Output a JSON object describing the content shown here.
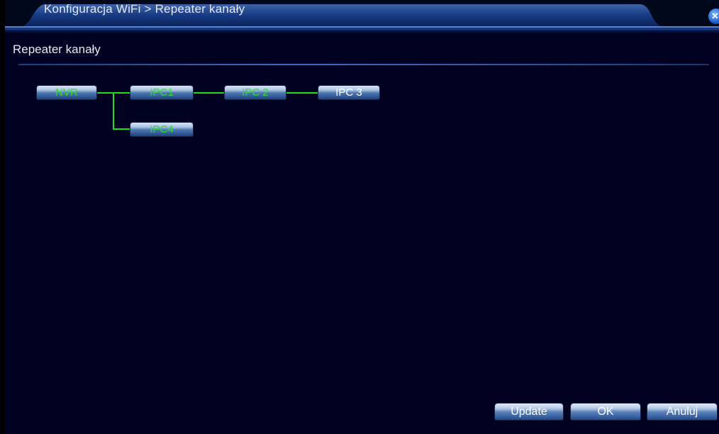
{
  "window": {
    "breadcrumb": "Konfiguracja WiFi > Repeater kanały",
    "close_glyph": "✕"
  },
  "section": {
    "title": "Repeater kanały"
  },
  "topology": {
    "nodes": [
      {
        "id": "nvr",
        "label": "NVR",
        "status": "connected"
      },
      {
        "id": "ipc1",
        "label": "IPC1",
        "status": "connected"
      },
      {
        "id": "ipc2",
        "label": "IPC 2",
        "status": "connected"
      },
      {
        "id": "ipc3",
        "label": "IPC 3",
        "status": "disconnected"
      },
      {
        "id": "ipc4",
        "label": "IPC4",
        "status": "connected"
      }
    ],
    "links": [
      {
        "from": "NVR",
        "to": "IPC1"
      },
      {
        "from": "IPC1",
        "to": "IPC 2"
      },
      {
        "from": "IPC 2",
        "to": "IPC 3"
      },
      {
        "from": "NVR",
        "to": "IPC4"
      }
    ],
    "colors": {
      "connected_text": "#22e622",
      "link_line": "#1ee01e",
      "disconnected_text": "#ffffff"
    }
  },
  "buttons": {
    "update_label": "Update",
    "ok_label": "OK",
    "cancel_label": "Anuluj"
  },
  "colors": {
    "background": "#010222",
    "title_bar": "#0f2c6a",
    "accent": "#3b6ac0"
  }
}
